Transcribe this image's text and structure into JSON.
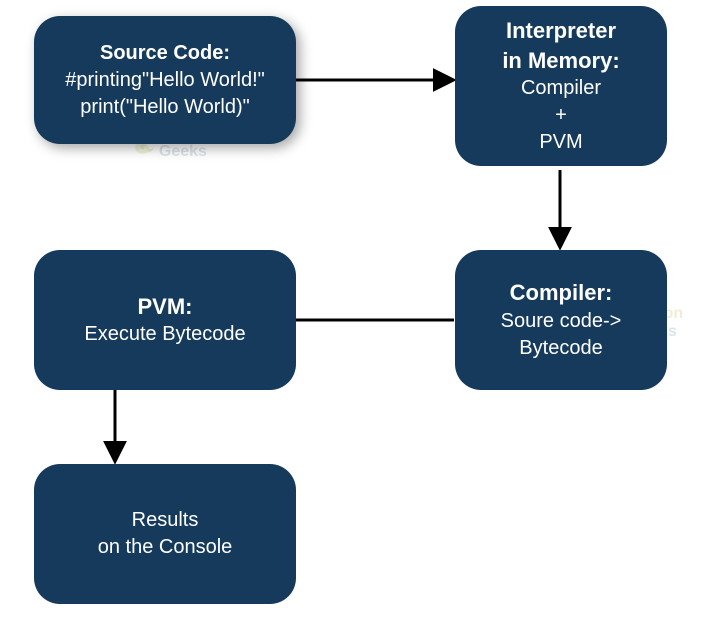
{
  "boxes": {
    "source": {
      "title": "Source Code:",
      "line1": "#printing\"Hello World!\"",
      "line2": "print(\"Hello World)\""
    },
    "interpreter": {
      "title1": "Interpreter",
      "title2": "in Memory:",
      "line1": "Compiler",
      "line2": "+",
      "line3": "PVM"
    },
    "compiler": {
      "title": "Compiler:",
      "line1": "Soure code->",
      "line2": "Bytecode"
    },
    "pvm": {
      "title": "PVM:",
      "line1": "Execute Bytecode"
    },
    "results": {
      "line1": "Results",
      "line2": "on the Console"
    }
  },
  "watermark": {
    "brand1": "Python",
    "brand2": "Geeks"
  },
  "colors": {
    "boxFill": "#153a5b",
    "boxText": "#ffffff",
    "connector": "#000000"
  }
}
